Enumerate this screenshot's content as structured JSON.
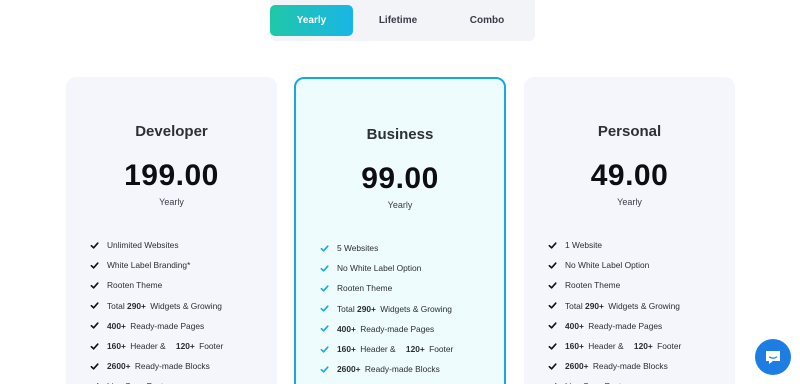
{
  "tabs": [
    {
      "label": "Yearly",
      "active": true
    },
    {
      "label": "Lifetime",
      "active": false
    },
    {
      "label": "Combo",
      "active": false
    }
  ],
  "plans": [
    {
      "name": "Developer",
      "price": "199.00",
      "period": "Yearly",
      "features": [
        {
          "text": "Unlimited Websites"
        },
        {
          "text": "White Label Branding*"
        },
        {
          "text": "Rooten Theme"
        },
        {
          "pre": "Total ",
          "bold": "290+",
          "text": " Widgets & Growing"
        },
        {
          "bold": "400+",
          "text": " Ready-made Pages"
        },
        {
          "bold": "160+",
          "text": " Header & ",
          "bold2": "120+",
          "text2": " Footer"
        },
        {
          "bold": "2600+",
          "text": " Ready-made Blocks"
        },
        {
          "text": "Live Copy Paste"
        }
      ]
    },
    {
      "name": "Business",
      "price": "99.00",
      "period": "Yearly",
      "featured": true,
      "features": [
        {
          "text": "5 Websites"
        },
        {
          "text": "No White Label Option"
        },
        {
          "text": "Rooten Theme"
        },
        {
          "pre": "Total ",
          "bold": "290+",
          "text": " Widgets & Growing"
        },
        {
          "bold": "400+",
          "text": " Ready-made Pages"
        },
        {
          "bold": "160+",
          "text": " Header & ",
          "bold2": "120+",
          "text2": " Footer"
        },
        {
          "bold": "2600+",
          "text": " Ready-made Blocks"
        },
        {
          "text": "Live Copy Paste"
        }
      ]
    },
    {
      "name": "Personal",
      "price": "49.00",
      "period": "Yearly",
      "features": [
        {
          "text": "1 Website"
        },
        {
          "text": "No White Label Option"
        },
        {
          "text": "Rooten Theme"
        },
        {
          "pre": "Total ",
          "bold": "290+",
          "text": " Widgets & Growing"
        },
        {
          "bold": "400+",
          "text": " Ready-made Pages"
        },
        {
          "bold": "160+",
          "text": " Header & ",
          "bold2": "120+",
          "text2": " Footer"
        },
        {
          "bold": "2600+",
          "text": " Ready-made Blocks"
        },
        {
          "text": "Live Copy Paste"
        }
      ]
    }
  ],
  "chat": {
    "icon": "chat-bubble-icon"
  },
  "colors": {
    "accent_start": "#20c7a8",
    "accent_end": "#19b6e6",
    "featured_border": "#17a9de",
    "chat_button": "#1d7de3"
  }
}
